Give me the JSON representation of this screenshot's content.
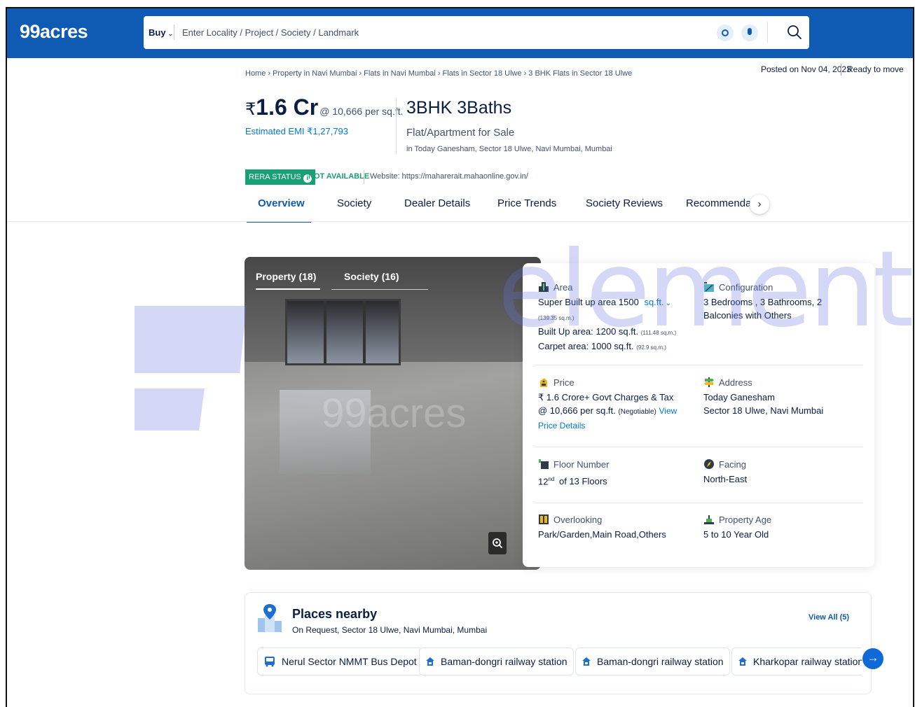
{
  "header": {
    "logo": "99acres",
    "buy_label": "Buy",
    "search_placeholder": "Enter Locality / Project / Society / Landmark"
  },
  "breadcrumb": [
    "Home",
    "Property in Navi Mumbai",
    "Flats in Navi Mumbai",
    "Flats in Sector 18 Ulwe",
    "3 BHK Flats in Sector 18 Ulwe"
  ],
  "meta": {
    "posted": "Posted on Nov 04, 2023",
    "status": "Ready to move"
  },
  "price": {
    "symbol": "₹",
    "amount": "1.6 Cr",
    "per_sqft": "@ 10,666 per sq.ft.",
    "emi": "Estimated EMI ₹1,27,793"
  },
  "property": {
    "bhk": "3BHK 3Baths",
    "type": "Flat/Apartment for Sale",
    "location": "in Today Ganesham, Sector 18 Ulwe, Navi Mumbai, Mumbai"
  },
  "rera": {
    "badge": "RERA STATUS",
    "info_glyph": "i",
    "status": "NOT AVAILABLE",
    "website": "Website: https://maharerait.mahaonline.gov.in/"
  },
  "tabs": [
    {
      "label": "Overview",
      "active": true
    },
    {
      "label": "Society",
      "active": false
    },
    {
      "label": "Dealer Details",
      "active": false
    },
    {
      "label": "Price Trends",
      "active": false
    },
    {
      "label": "Society Reviews",
      "active": false
    },
    {
      "label": "Recommendatic",
      "active": false
    }
  ],
  "tabs_next_glyph": "›",
  "gallery": {
    "tabs": [
      "Property (18)",
      "Society (16)"
    ],
    "watermark": "99acres"
  },
  "details": {
    "area": {
      "label": "Area",
      "super_built_up": "Super Built up area 1500",
      "unit": "sq.ft.",
      "super_sqm": "(139.35 sq.m.)",
      "built_up": "Built Up area: 1200 sq.ft.",
      "built_up_sqm": "(111.48 sq.m.)",
      "carpet": "Carpet area: 1000 sq.ft.",
      "carpet_sqm": "(92.9 sq.m.)"
    },
    "configuration": {
      "label": "Configuration",
      "value": "3 Bedrooms , 3 Bathrooms, 2 Balconies with Others"
    },
    "price": {
      "label": "Price",
      "line1": "₹ 1.6 Crore+ Govt Charges & Tax",
      "line2": "@ 10,666 per sq.ft.",
      "negotiable": "(Negotiable)",
      "link": "View Price Details"
    },
    "address": {
      "label": "Address",
      "line1": "Today Ganesham",
      "line2": "Sector 18 Ulwe, Navi Mumbai"
    },
    "floor": {
      "label": "Floor Number",
      "num": "12",
      "suffix": "nd",
      "rest": "of 13 Floors"
    },
    "facing": {
      "label": "Facing",
      "value": "North-East"
    },
    "overlooking": {
      "label": "Overlooking",
      "value": "Park/Garden,Main Road,Others"
    },
    "age": {
      "label": "Property Age",
      "value": "5 to 10 Year Old"
    }
  },
  "places": {
    "title": "Places nearby",
    "subtitle": "On Request, Sector 18 Ulwe, Navi Mumbai, Mumbai",
    "view_all": "View All (5)",
    "chips": [
      "Nerul Sector NMMT Bus Depot",
      "Baman-dongri railway station",
      "Baman-dongri railway station",
      "Kharkopar railway station"
    ],
    "next_glyph": "→"
  },
  "watermark": "element",
  "colors": {
    "brand_blue": "#0f5ab3",
    "link_blue": "#0078db",
    "rera_green": "#1a9e73",
    "text_dark": "#091e42",
    "text_muted": "#42526e"
  }
}
